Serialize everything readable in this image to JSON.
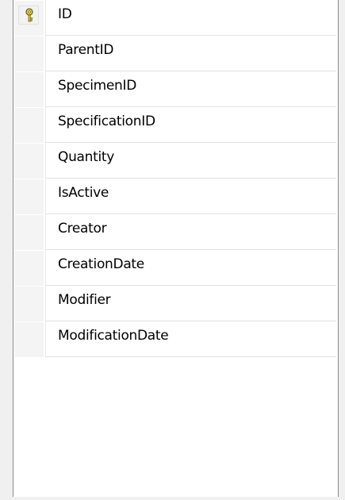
{
  "table": {
    "columns": [
      {
        "name": "ID",
        "primary_key": true
      },
      {
        "name": "ParentID",
        "primary_key": false
      },
      {
        "name": "SpecimenID",
        "primary_key": false
      },
      {
        "name": "SpecificationID",
        "primary_key": false
      },
      {
        "name": "Quantity",
        "primary_key": false
      },
      {
        "name": "IsActive",
        "primary_key": false
      },
      {
        "name": "Creator",
        "primary_key": false
      },
      {
        "name": "CreationDate",
        "primary_key": false
      },
      {
        "name": "Modifier",
        "primary_key": false
      },
      {
        "name": "ModificationDate",
        "primary_key": false
      }
    ],
    "key_icon": "primary-key-icon",
    "colors": {
      "key_fill": "#e8d34a",
      "key_outline": "#6b5a10",
      "grid_line": "#e2e2e2",
      "border": "#8a8a8a"
    }
  }
}
